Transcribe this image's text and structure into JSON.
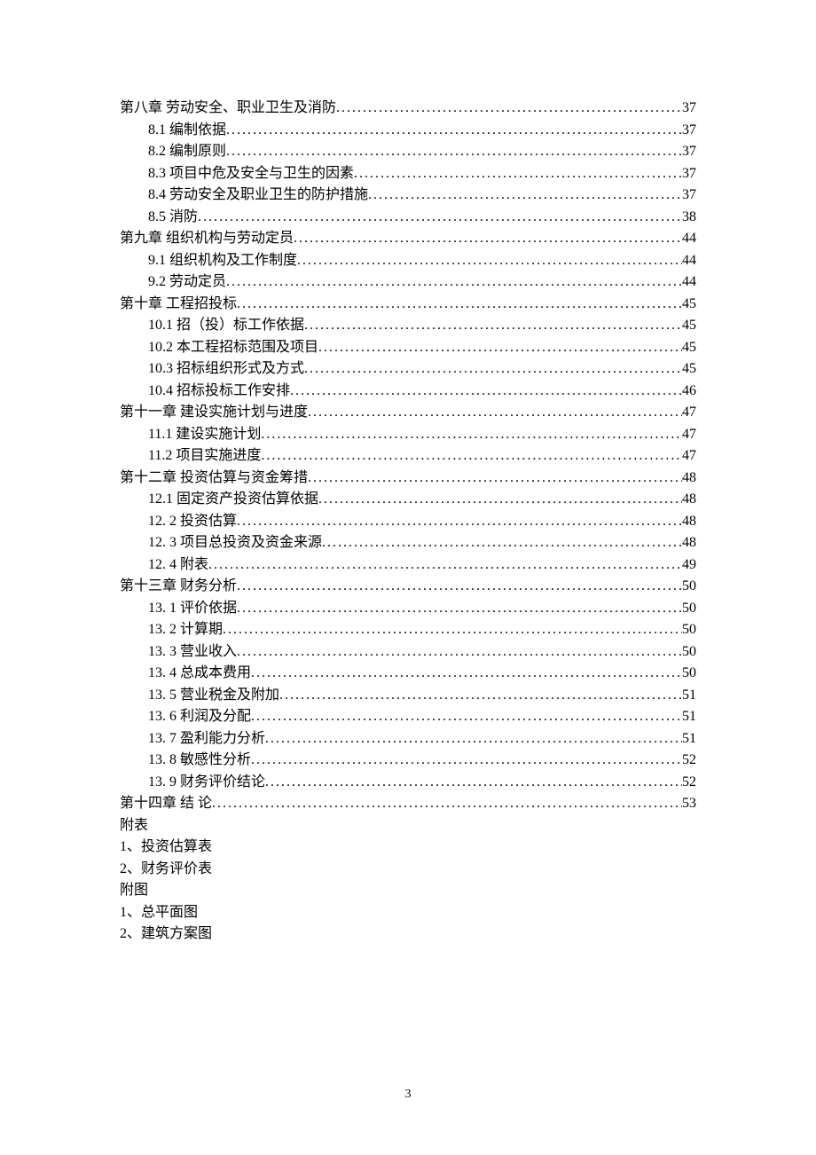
{
  "toc": [
    {
      "level": 0,
      "label": "第八章 劳动安全、职业卫生及消防",
      "page": "37"
    },
    {
      "level": 1,
      "label": "8.1 编制依据",
      "page": "37"
    },
    {
      "level": 1,
      "label": "8.2 编制原则",
      "page": "37"
    },
    {
      "level": 1,
      "label": "8.3 项目中危及安全与卫生的因素",
      "page": "37"
    },
    {
      "level": 1,
      "label": "8.4 劳动安全及职业卫生的防护措施",
      "page": "37"
    },
    {
      "level": 1,
      "label": "8.5  消防",
      "page": "38"
    },
    {
      "level": 0,
      "label": "第九章   组织机构与劳动定员",
      "page": "44"
    },
    {
      "level": 1,
      "label": "9.1  组织机构及工作制度",
      "page": "44"
    },
    {
      "level": 1,
      "label": "9.2  劳动定员",
      "page": "44"
    },
    {
      "level": 0,
      "label": "第十章  工程招投标",
      "page": "45"
    },
    {
      "level": 1,
      "label": "10.1 招（投）标工作依据",
      "page": "45"
    },
    {
      "level": 1,
      "label": "10.2 本工程招标范围及项目",
      "page": "45"
    },
    {
      "level": 1,
      "label": "10.3 招标组织形式及方式",
      "page": "45"
    },
    {
      "level": 1,
      "label": "10.4 招标投标工作安排",
      "page": "46"
    },
    {
      "level": 0,
      "label": "第十一章   建设实施计划与进度",
      "page": "47"
    },
    {
      "level": 1,
      "label": "11.1 建设实施计划",
      "page": "47"
    },
    {
      "level": 1,
      "label": "11.2 项目实施进度",
      "page": "47"
    },
    {
      "level": 0,
      "label": "第十二章   投资估算与资金筹措",
      "page": "48"
    },
    {
      "level": 1,
      "label": "12.1 固定资产投资估算依据",
      "page": "48"
    },
    {
      "level": 1,
      "label": "12. 2  投资估算",
      "page": "48"
    },
    {
      "level": 1,
      "label": "12. 3 项目总投资及资金来源",
      "page": "48"
    },
    {
      "level": 1,
      "label": "12. 4  附表",
      "page": "49"
    },
    {
      "level": 0,
      "label": "第十三章   财务分析",
      "page": "50"
    },
    {
      "level": 1,
      "label": "13. 1 评价依据",
      "page": "50"
    },
    {
      "level": 1,
      "label": "13. 2 计算期",
      "page": "50"
    },
    {
      "level": 1,
      "label": "13. 3 营业收入",
      "page": "50"
    },
    {
      "level": 1,
      "label": "13. 4 总成本费用",
      "page": "50"
    },
    {
      "level": 1,
      "label": "13. 5 营业税金及附加",
      "page": "51"
    },
    {
      "level": 1,
      "label": "13. 6 利润及分配",
      "page": "51"
    },
    {
      "level": 1,
      "label": "13. 7 盈利能力分析",
      "page": "51"
    },
    {
      "level": 1,
      "label": "13. 8 敏感性分析",
      "page": "52"
    },
    {
      "level": 1,
      "label": "13. 9 财务评价结论",
      "page": "52"
    },
    {
      "level": 0,
      "label": "第十四章 结        论",
      "page": "53"
    }
  ],
  "plain": [
    "附表",
    "1、投资估算表",
    "2、财务评价表",
    "附图",
    "1、总平面图",
    "2、建筑方案图"
  ],
  "page_number": "3"
}
